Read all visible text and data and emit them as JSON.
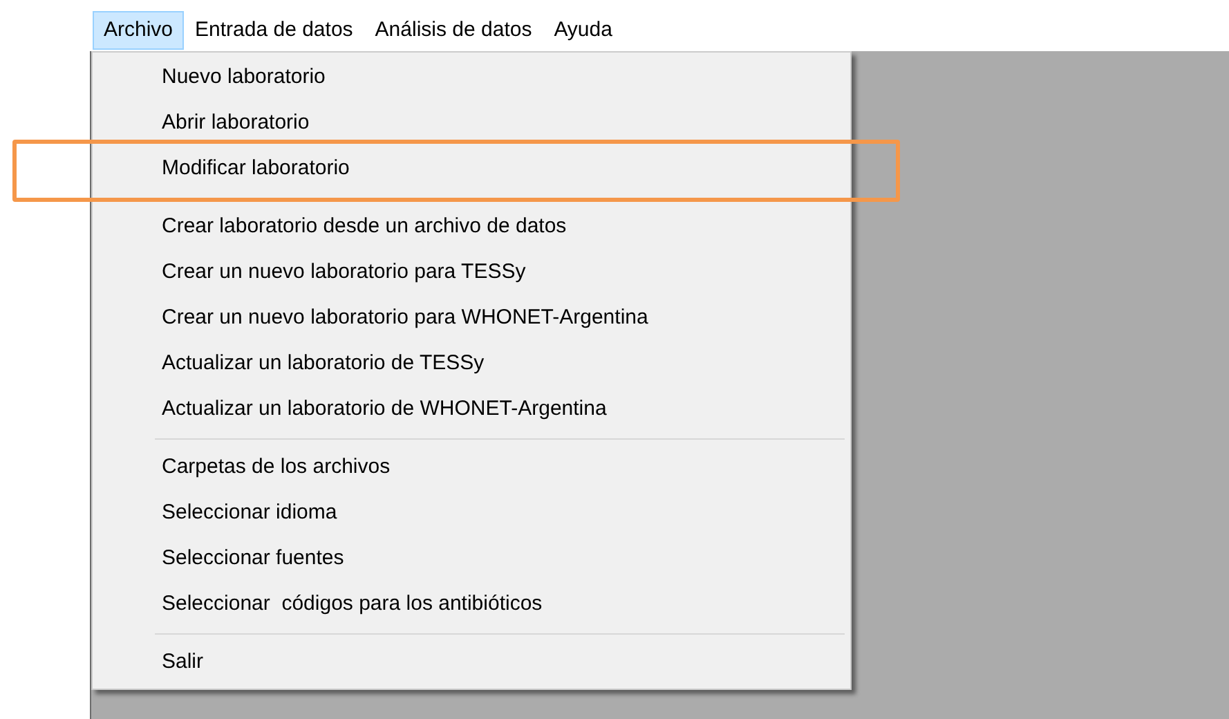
{
  "menubar": [
    {
      "label": "Archivo",
      "selected": true
    },
    {
      "label": "Entrada de datos",
      "selected": false
    },
    {
      "label": "Análisis de datos",
      "selected": false
    },
    {
      "label": "Ayuda",
      "selected": false
    }
  ],
  "menu": {
    "groups": [
      [
        {
          "label": "Nuevo laboratorio",
          "annotated": false
        },
        {
          "label": "Abrir laboratorio",
          "annotated": false
        },
        {
          "label": "Modificar laboratorio",
          "annotated": true
        }
      ],
      [
        {
          "label": "Crear laboratorio desde un archivo de datos",
          "annotated": false
        },
        {
          "label": "Crear un nuevo laboratorio para TESSy",
          "annotated": false
        },
        {
          "label": "Crear un nuevo laboratorio para WHONET-Argentina",
          "annotated": false
        },
        {
          "label": "Actualizar un laboratorio de TESSy",
          "annotated": false
        },
        {
          "label": "Actualizar un laboratorio de WHONET-Argentina",
          "annotated": false
        }
      ],
      [
        {
          "label": "Carpetas de los archivos",
          "annotated": false
        },
        {
          "label": "Seleccionar idioma",
          "annotated": false
        },
        {
          "label": "Seleccionar fuentes",
          "annotated": false
        },
        {
          "label": "Seleccionar  códigos para los antibióticos",
          "annotated": false
        }
      ],
      [
        {
          "label": "Salir",
          "annotated": false
        }
      ]
    ]
  }
}
